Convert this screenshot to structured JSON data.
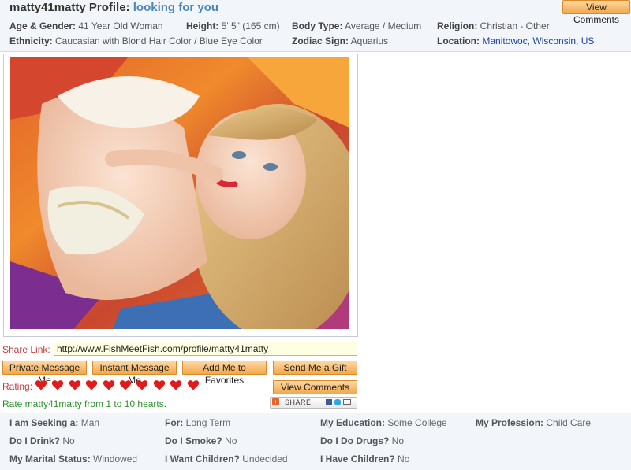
{
  "profile": {
    "username_title": "matty41matty Profile:",
    "tagline": "looking for you",
    "view_comments": "View Comments",
    "fields": [
      {
        "label": "Age & Gender:",
        "value": "41 Year Old Woman"
      },
      {
        "label": "Height:",
        "value": "5' 5\" (165 cm)"
      },
      {
        "label": "Body Type:",
        "value": "Average / Medium"
      },
      {
        "label": "Religion:",
        "value": "Christian - Other"
      },
      {
        "label": "Ethnicity:",
        "value": "Caucasian with Blond Hair Color / Blue Eye Color"
      },
      {
        "label": "Zodiac Sign:",
        "value": "Aquarius"
      }
    ],
    "location": {
      "label": "Location:",
      "city": "Manitowoc",
      "state": "Wisconsin",
      "country": "US",
      "sep": ","
    }
  },
  "share": {
    "label": "Share Link:",
    "url": "http://www.FishMeetFish.com/profile/matty41matty"
  },
  "actions": {
    "private_message": "Private Message Me",
    "instant_message": "Instant Message Me",
    "add_favorites": "Add Me to Favorites",
    "send_gift": "Send Me a Gift",
    "view_comments": "View Comments"
  },
  "rating": {
    "label": "Rating:",
    "hearts_total": 10,
    "hearts_filled": 10,
    "heart_color": "#e01b1b",
    "rate_text": "Rate matty41matty from 1 to 10 hearts."
  },
  "share_widget": {
    "label": "SHARE"
  },
  "details": [
    {
      "label": "I am Seeking a:",
      "value": "Man"
    },
    {
      "label": "For:",
      "value": "Long Term"
    },
    {
      "label": "My Education:",
      "value": "Some College"
    },
    {
      "label": "My Profession:",
      "value": "Child Care"
    },
    {
      "label": "Do I Drink?",
      "value": "No"
    },
    {
      "label": "Do I Smoke?",
      "value": "No"
    },
    {
      "label": "Do I Do Drugs?",
      "value": "No"
    },
    {
      "label": "My Marital Status:",
      "value": "Windowed"
    },
    {
      "label": "I Want Children?",
      "value": "Undecided"
    },
    {
      "label": "I Have Children?",
      "value": "No"
    }
  ]
}
